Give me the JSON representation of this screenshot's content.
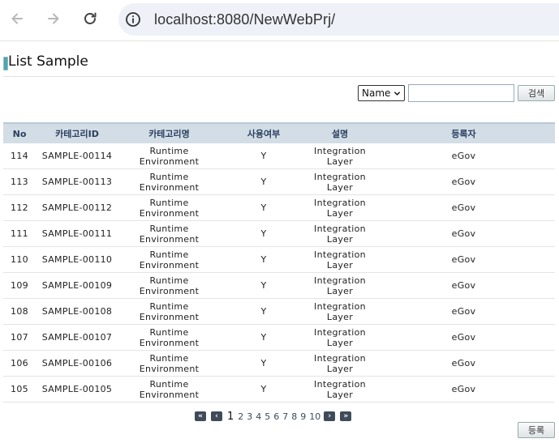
{
  "browser": {
    "url": "localhost:8080/NewWebPrj/"
  },
  "page": {
    "title": "List Sample"
  },
  "search": {
    "select_value": "Name",
    "input_value": "",
    "button_label": "검색"
  },
  "table": {
    "headers": [
      "No",
      "카테고리ID",
      "카테고리명",
      "사용여부",
      "설명",
      "등록자"
    ],
    "rows": [
      {
        "no": "114",
        "id": "SAMPLE-00114",
        "name": "Runtime Environment",
        "use": "Y",
        "desc": "Integration Layer",
        "reg": "eGov"
      },
      {
        "no": "113",
        "id": "SAMPLE-00113",
        "name": "Runtime Environment",
        "use": "Y",
        "desc": "Integration Layer",
        "reg": "eGov"
      },
      {
        "no": "112",
        "id": "SAMPLE-00112",
        "name": "Runtime Environment",
        "use": "Y",
        "desc": "Integration Layer",
        "reg": "eGov"
      },
      {
        "no": "111",
        "id": "SAMPLE-00111",
        "name": "Runtime Environment",
        "use": "Y",
        "desc": "Integration Layer",
        "reg": "eGov"
      },
      {
        "no": "110",
        "id": "SAMPLE-00110",
        "name": "Runtime Environment",
        "use": "Y",
        "desc": "Integration Layer",
        "reg": "eGov"
      },
      {
        "no": "109",
        "id": "SAMPLE-00109",
        "name": "Runtime Environment",
        "use": "Y",
        "desc": "Integration Layer",
        "reg": "eGov"
      },
      {
        "no": "108",
        "id": "SAMPLE-00108",
        "name": "Runtime Environment",
        "use": "Y",
        "desc": "Integration Layer",
        "reg": "eGov"
      },
      {
        "no": "107",
        "id": "SAMPLE-00107",
        "name": "Runtime Environment",
        "use": "Y",
        "desc": "Integration Layer",
        "reg": "eGov"
      },
      {
        "no": "106",
        "id": "SAMPLE-00106",
        "name": "Runtime Environment",
        "use": "Y",
        "desc": "Integration Layer",
        "reg": "eGov"
      },
      {
        "no": "105",
        "id": "SAMPLE-00105",
        "name": "Runtime Environment",
        "use": "Y",
        "desc": "Integration Layer",
        "reg": "eGov"
      }
    ]
  },
  "pagination": {
    "first_label": "«",
    "prev_label": "‹",
    "pages": [
      "1",
      "2",
      "3",
      "4",
      "5",
      "6",
      "7",
      "8",
      "9",
      "10"
    ],
    "current": "1",
    "next_label": "›",
    "last_label": "»"
  },
  "actions": {
    "register_label": "등록"
  },
  "icons": {
    "back": "arrow-left-icon",
    "forward": "arrow-right-icon",
    "reload": "reload-icon",
    "info": "info-icon",
    "dropdown": "chevron-down-icon"
  },
  "colors": {
    "header_bg": "#d3dde6",
    "header_text": "#2a3f60",
    "id_link": "#244b86",
    "title_marker": "#4aa7b3",
    "pager_button": "#3f4b59"
  }
}
